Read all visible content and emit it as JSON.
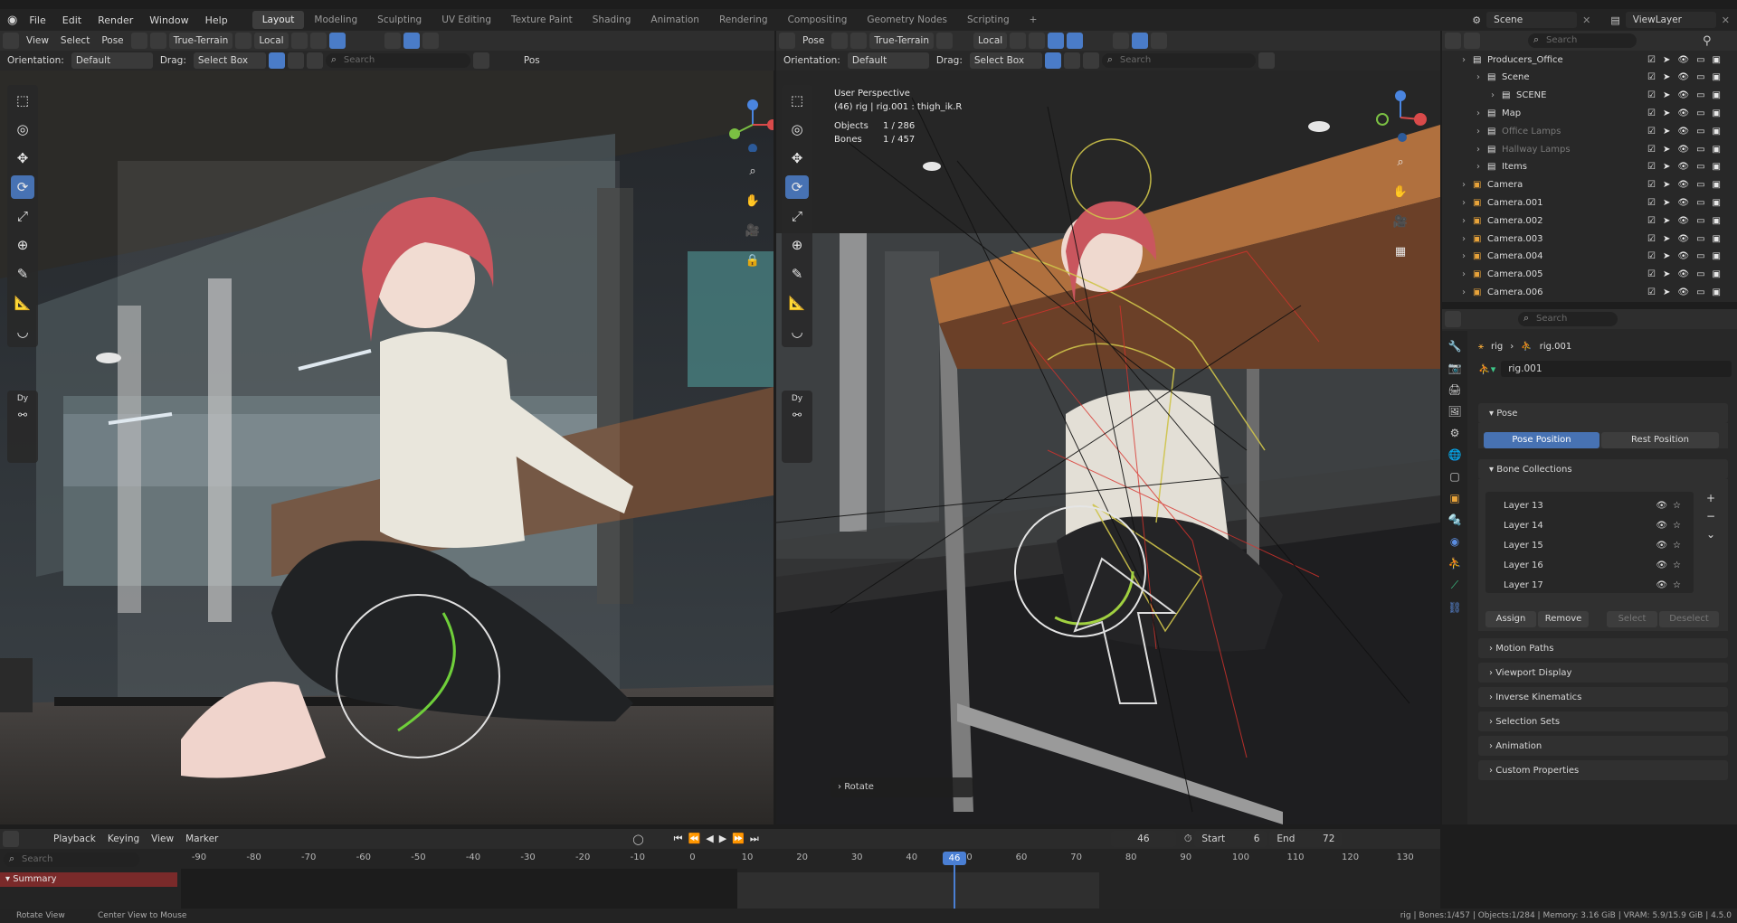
{
  "menu": {
    "items": [
      "File",
      "Edit",
      "Render",
      "Window",
      "Help"
    ]
  },
  "workspaces": {
    "tabs": [
      "Layout",
      "Modeling",
      "Sculpting",
      "UV Editing",
      "Texture Paint",
      "Shading",
      "Animation",
      "Rendering",
      "Compositing",
      "Geometry Nodes",
      "Scripting"
    ],
    "active": "Layout",
    "add": "+"
  },
  "scene": {
    "name": "Scene",
    "view_layer": "ViewLayer"
  },
  "left_viewport": {
    "header": {
      "mode": "Pose",
      "snap": "True-Terrain",
      "pivot": "Local"
    },
    "header2": {
      "orientation_label": "Orientation:",
      "orientation": "Default",
      "drag_label": "Drag:",
      "drag": "Select Box",
      "search": "Search",
      "pos": "Pos"
    },
    "header_menu": [
      "View",
      "Select",
      "Pose"
    ],
    "collapsed_panel": "Dy"
  },
  "right_viewport": {
    "header": {
      "mode": "Pose",
      "snap": "True-Terrain",
      "pivot": "Local"
    },
    "header2": {
      "orientation_label": "Orientation:",
      "orientation": "Default",
      "drag_label": "Drag:",
      "drag": "Select Box",
      "search": "Search"
    },
    "overlay": {
      "perspective": "User Perspective",
      "context": "(46) rig | rig.001 : thigh_ik.R",
      "objects_label": "Objects",
      "objects_value": "1 / 286",
      "bones_label": "Bones",
      "bones_value": "1 / 457"
    },
    "operator_panel": "Rotate",
    "collapsed_panel": "Dy"
  },
  "outliner": {
    "search": "Search",
    "rows": [
      {
        "name": "Producers_Office",
        "indent": 1
      },
      {
        "name": "Scene",
        "indent": 2
      },
      {
        "name": "SCENE",
        "indent": 3
      },
      {
        "name": "Map",
        "indent": 2
      },
      {
        "name": "Office Lamps",
        "indent": 2,
        "dim": true
      },
      {
        "name": "Hallway Lamps",
        "indent": 2,
        "dim": true
      },
      {
        "name": "Items",
        "indent": 2
      },
      {
        "name": "Camera",
        "indent": 1
      },
      {
        "name": "Camera.001",
        "indent": 1
      },
      {
        "name": "Camera.002",
        "indent": 1
      },
      {
        "name": "Camera.003",
        "indent": 1
      },
      {
        "name": "Camera.004",
        "indent": 1
      },
      {
        "name": "Camera.005",
        "indent": 1
      },
      {
        "name": "Camera.006",
        "indent": 1
      }
    ]
  },
  "properties": {
    "search": "Search",
    "breadcrumb": {
      "object": "rig",
      "data": "rig.001"
    },
    "armature_name": "rig.001",
    "pose_panel": "Pose",
    "pose_position": "Pose Position",
    "rest_position": "Rest Position",
    "bone_collections": "Bone Collections",
    "layers": [
      "Layer 13",
      "Layer 14",
      "Layer 15",
      "Layer 16",
      "Layer 17"
    ],
    "buttons": {
      "assign": "Assign",
      "remove": "Remove",
      "select": "Select",
      "deselect": "Deselect"
    },
    "panels": [
      "Motion Paths",
      "Viewport Display",
      "Inverse Kinematics",
      "Selection Sets",
      "Animation",
      "Custom Properties"
    ]
  },
  "timeline": {
    "menus": [
      "Playback",
      "Keying",
      "View",
      "Marker"
    ],
    "current_frame": "46",
    "start_label": "Start",
    "start": "6",
    "end_label": "End",
    "end": "72",
    "search": "Search",
    "summary": "Summary",
    "ticks": [
      "-90",
      "-80",
      "-70",
      "-60",
      "-50",
      "-40",
      "-30",
      "-20",
      "-10",
      "0",
      "10",
      "20",
      "30",
      "40",
      "50",
      "60",
      "70",
      "80",
      "90",
      "100",
      "110",
      "120",
      "130"
    ],
    "playhead_label": "46"
  },
  "statusbar": {
    "left1": "Rotate View",
    "left2": "Center View to Mouse",
    "right": "rig | Bones:1/457 | Objects:1/284 | Memory: 3.16 GiB | VRAM: 5.9/15.9 GiB | 4.5.0"
  },
  "colors": {
    "accent": "#4772b3",
    "summary_bg": "#7a2a2a",
    "playhead": "#4a7fd4"
  }
}
